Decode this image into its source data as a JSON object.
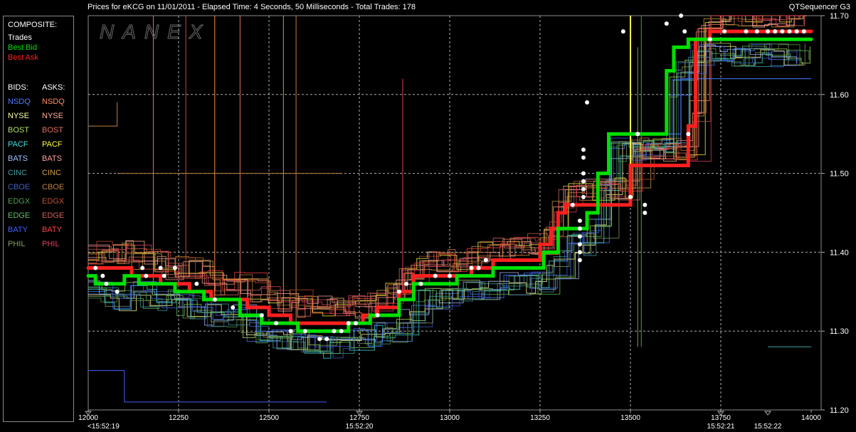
{
  "header": {
    "title": "Prices for  eKCG  on  11/01/2011  -  Elapsed Time: 4 Seconds, 50 Milliseconds  -  Total Trades: 178",
    "app_name": "QTSequencer G3",
    "watermark": "NANEX"
  },
  "legend": {
    "composite_label": "COMPOSITE:",
    "composite": [
      {
        "label": "Trades",
        "color": "#ffffff"
      },
      {
        "label": "Best Bid",
        "color": "#00e000"
      },
      {
        "label": "Best Ask",
        "color": "#ff2020"
      }
    ],
    "bids_label": "BIDS:",
    "asks_label": "ASKS:",
    "exchanges": [
      {
        "bid": "NSDQ",
        "ask": "NSDQ",
        "bid_color": "#4a7cff",
        "ask_color": "#ff8c5a"
      },
      {
        "bid": "NYSE",
        "ask": "NYSE",
        "bid_color": "#ffffa0",
        "ask_color": "#ffb090"
      },
      {
        "bid": "BOST",
        "ask": "BOST",
        "bid_color": "#b0e060",
        "ask_color": "#e07060"
      },
      {
        "bid": "PACF",
        "ask": "PACF",
        "bid_color": "#40e0e0",
        "ask_color": "#ffff40"
      },
      {
        "bid": "BATS",
        "ask": "BATS",
        "bid_color": "#a0c0ff",
        "ask_color": "#ffa0a0"
      },
      {
        "bid": "CINC",
        "ask": "CINC",
        "bid_color": "#40a0a0",
        "ask_color": "#d0a040"
      },
      {
        "bid": "CBOE",
        "ask": "CBOE",
        "bid_color": "#4060c0",
        "ask_color": "#c08040"
      },
      {
        "bid": "EDGX",
        "ask": "EDGX",
        "bid_color": "#50a050",
        "ask_color": "#c05030"
      },
      {
        "bid": "EDGE",
        "ask": "EDGE",
        "bid_color": "#60c060",
        "ask_color": "#d06050"
      },
      {
        "bid": "BATY",
        "ask": "BATY",
        "bid_color": "#4060ff",
        "ask_color": "#ff4040"
      },
      {
        "bid": "PHIL",
        "ask": "PHIL",
        "bid_color": "#80a060",
        "ask_color": "#e04060"
      }
    ]
  },
  "chart_data": {
    "type": "line",
    "x_ticks": [
      "12000",
      "12250",
      "12500",
      "12750",
      "13000",
      "13250",
      "13500",
      "13750",
      "14000"
    ],
    "time_labels": [
      {
        "x": 12000,
        "label": "<15:52:19"
      },
      {
        "x": 12750,
        "label": "15:52:20"
      },
      {
        "x": 13750,
        "label": "15:52:21"
      },
      {
        "x": 13880,
        "label": "15:52:22"
      }
    ],
    "y_ticks": [
      "11.70",
      "11.60",
      "11.50",
      "11.40",
      "11.30",
      "11.20"
    ],
    "xlim": [
      12000,
      14000
    ],
    "ylim": [
      11.2,
      11.7
    ],
    "grid": true,
    "series": [
      {
        "name": "Best Ask",
        "color": "#ff2020",
        "points": [
          [
            12000,
            11.38
          ],
          [
            12120,
            11.38
          ],
          [
            12120,
            11.37
          ],
          [
            12200,
            11.37
          ],
          [
            12200,
            11.36
          ],
          [
            12280,
            11.36
          ],
          [
            12280,
            11.35
          ],
          [
            12340,
            11.35
          ],
          [
            12340,
            11.34
          ],
          [
            12440,
            11.34
          ],
          [
            12440,
            11.33
          ],
          [
            12500,
            11.33
          ],
          [
            12500,
            11.32
          ],
          [
            12560,
            11.32
          ],
          [
            12560,
            11.31
          ],
          [
            12760,
            11.31
          ],
          [
            12760,
            11.32
          ],
          [
            12800,
            11.32
          ],
          [
            12800,
            11.33
          ],
          [
            12860,
            11.33
          ],
          [
            12860,
            11.35
          ],
          [
            12900,
            11.35
          ],
          [
            12900,
            11.37
          ],
          [
            13060,
            11.37
          ],
          [
            13060,
            11.38
          ],
          [
            13120,
            11.38
          ],
          [
            13120,
            11.39
          ],
          [
            13250,
            11.39
          ],
          [
            13250,
            11.41
          ],
          [
            13280,
            11.41
          ],
          [
            13280,
            11.43
          ],
          [
            13300,
            11.43
          ],
          [
            13300,
            11.45
          ],
          [
            13320,
            11.45
          ],
          [
            13320,
            11.46
          ],
          [
            13500,
            11.46
          ],
          [
            13500,
            11.51
          ],
          [
            13660,
            11.51
          ],
          [
            13660,
            11.56
          ],
          [
            13680,
            11.56
          ],
          [
            13680,
            11.67
          ],
          [
            13720,
            11.67
          ],
          [
            13720,
            11.68
          ],
          [
            14000,
            11.68
          ]
        ]
      },
      {
        "name": "Best Bid",
        "color": "#00e000",
        "points": [
          [
            12000,
            11.37
          ],
          [
            12020,
            11.37
          ],
          [
            12020,
            11.36
          ],
          [
            12100,
            11.36
          ],
          [
            12100,
            11.37
          ],
          [
            12140,
            11.37
          ],
          [
            12140,
            11.36
          ],
          [
            12240,
            11.36
          ],
          [
            12240,
            11.35
          ],
          [
            12320,
            11.35
          ],
          [
            12320,
            11.34
          ],
          [
            12420,
            11.34
          ],
          [
            12420,
            11.32
          ],
          [
            12480,
            11.32
          ],
          [
            12480,
            11.31
          ],
          [
            12580,
            11.31
          ],
          [
            12580,
            11.3
          ],
          [
            12720,
            11.3
          ],
          [
            12720,
            11.31
          ],
          [
            12780,
            11.31
          ],
          [
            12780,
            11.32
          ],
          [
            12860,
            11.32
          ],
          [
            12860,
            11.34
          ],
          [
            12900,
            11.34
          ],
          [
            12900,
            11.36
          ],
          [
            13020,
            11.36
          ],
          [
            13020,
            11.37
          ],
          [
            13120,
            11.37
          ],
          [
            13120,
            11.38
          ],
          [
            13260,
            11.38
          ],
          [
            13260,
            11.4
          ],
          [
            13300,
            11.4
          ],
          [
            13300,
            11.43
          ],
          [
            13380,
            11.43
          ],
          [
            13380,
            11.45
          ],
          [
            13410,
            11.45
          ],
          [
            13410,
            11.5
          ],
          [
            13440,
            11.5
          ],
          [
            13440,
            11.55
          ],
          [
            13600,
            11.55
          ],
          [
            13600,
            11.63
          ],
          [
            13620,
            11.63
          ],
          [
            13620,
            11.66
          ],
          [
            13660,
            11.66
          ],
          [
            13660,
            11.67
          ],
          [
            14000,
            11.67
          ]
        ]
      }
    ],
    "trades": [
      [
        12020,
        11.38
      ],
      [
        12040,
        11.37
      ],
      [
        12050,
        11.36
      ],
      [
        12080,
        11.35
      ],
      [
        12150,
        11.38
      ],
      [
        12160,
        11.37
      ],
      [
        12200,
        11.38
      ],
      [
        12210,
        11.37
      ],
      [
        12240,
        11.38
      ],
      [
        12300,
        11.36
      ],
      [
        12350,
        11.34
      ],
      [
        12400,
        11.33
      ],
      [
        12480,
        11.32
      ],
      [
        12520,
        11.31
      ],
      [
        12560,
        11.3
      ],
      [
        12600,
        11.3
      ],
      [
        12640,
        11.29
      ],
      [
        12660,
        11.29
      ],
      [
        12680,
        11.3
      ],
      [
        12700,
        11.3
      ],
      [
        12720,
        11.31
      ],
      [
        12740,
        11.31
      ],
      [
        12800,
        11.32
      ],
      [
        12860,
        11.35
      ],
      [
        12880,
        11.36
      ],
      [
        12920,
        11.36
      ],
      [
        12960,
        11.37
      ],
      [
        13000,
        11.37
      ],
      [
        13060,
        11.38
      ],
      [
        13080,
        11.38
      ],
      [
        13100,
        11.39
      ],
      [
        13340,
        11.46
      ],
      [
        13360,
        11.44
      ],
      [
        13360,
        11.43
      ],
      [
        13360,
        11.42
      ],
      [
        13360,
        11.41
      ],
      [
        13360,
        11.4
      ],
      [
        13360,
        11.39
      ],
      [
        13370,
        11.53
      ],
      [
        13370,
        11.52
      ],
      [
        13370,
        11.49
      ],
      [
        13370,
        11.48
      ],
      [
        13370,
        11.47
      ],
      [
        13370,
        11.5
      ],
      [
        13380,
        11.59
      ],
      [
        13480,
        11.68
      ],
      [
        13500,
        11.47
      ],
      [
        13520,
        11.55
      ],
      [
        13540,
        11.46
      ],
      [
        13540,
        11.45
      ],
      [
        13600,
        11.69
      ],
      [
        13640,
        11.7
      ],
      [
        13650,
        11.68
      ],
      [
        13660,
        11.55
      ],
      [
        13720,
        11.67
      ],
      [
        13760,
        11.68
      ],
      [
        13820,
        11.68
      ],
      [
        13850,
        11.68
      ],
      [
        13880,
        11.68
      ],
      [
        13900,
        11.68
      ],
      [
        13920,
        11.68
      ],
      [
        13940,
        11.68
      ],
      [
        13960,
        11.68
      ],
      [
        13980,
        11.68
      ]
    ]
  }
}
